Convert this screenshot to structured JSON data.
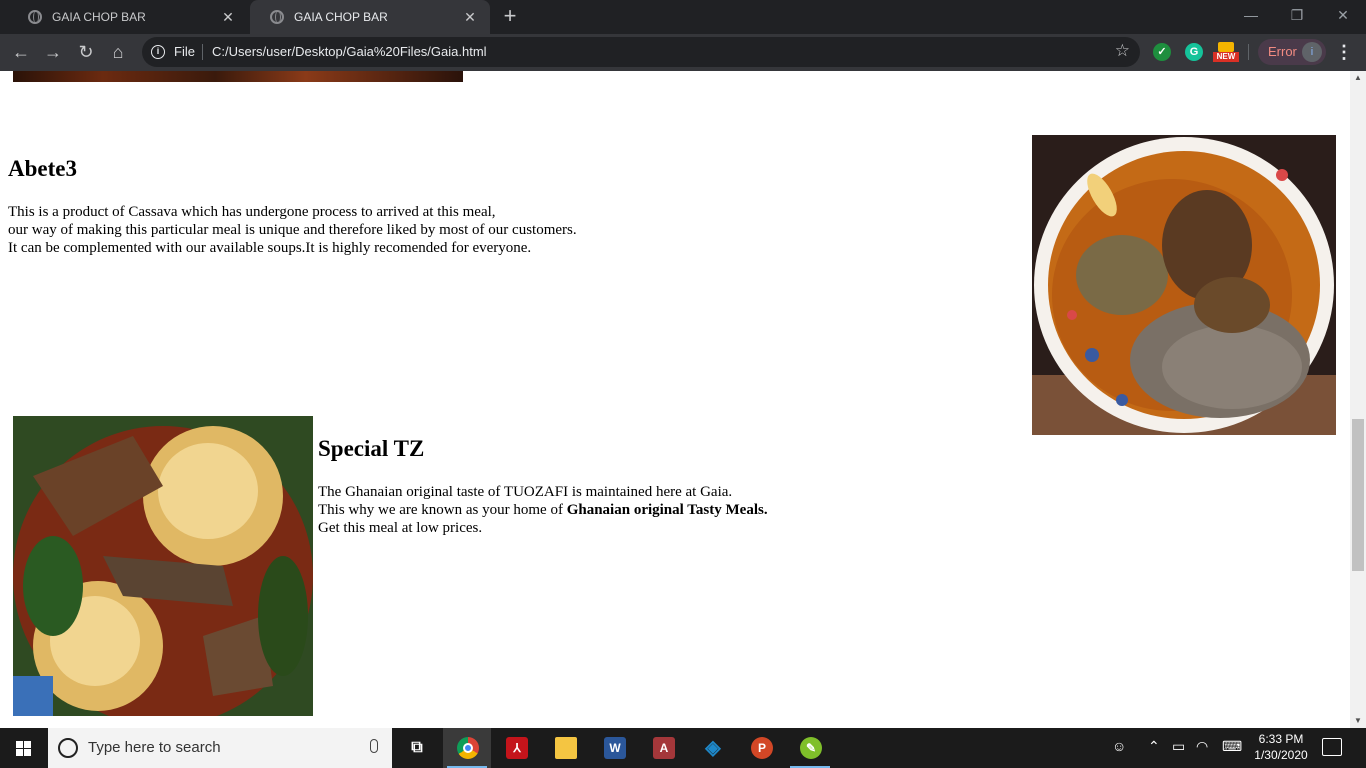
{
  "browser": {
    "tabs": [
      {
        "title": "GAIA CHOP BAR",
        "active": false
      },
      {
        "title": "GAIA CHOP BAR",
        "active": true
      }
    ],
    "address": {
      "scheme_label": "File",
      "url": "C:/Users/user/Desktop/Gaia%20Files/Gaia.html"
    },
    "extensions": {
      "grammarly": "G",
      "new_badge": "NEW"
    },
    "profile": {
      "status": "Error",
      "avatar_initial": "i"
    },
    "icons": {
      "back": "back-arrow-icon",
      "forward": "forward-arrow-icon",
      "reload": "reload-icon",
      "home": "home-icon",
      "bookmark": "star-icon",
      "menu": "kebab-menu-icon"
    }
  },
  "page": {
    "abete": {
      "heading": "Abete3",
      "lines": [
        "This is a product of Cassava which has undergone process to arrived at this meal,",
        "our way of making this particular meal is unique and therefore liked by most of our customers.",
        "It can be complemented with our available soups.It is highly recomended for everyone."
      ]
    },
    "tz": {
      "heading": "Special TZ",
      "line1": "The Ghanaian original taste of TUOZAFI is maintained here at Gaia.",
      "line2_prefix": "This why we are known as your home of ",
      "line2_bold": "Ghanaian original Tasty Meals.",
      "line3": "Get this meal at low prices."
    }
  },
  "taskbar": {
    "search_placeholder": "Type here to search",
    "apps": [
      {
        "name": "chrome",
        "label": "",
        "color": "#fbbc05"
      },
      {
        "name": "acrobat",
        "label": "",
        "color": "#c4141b"
      },
      {
        "name": "file-explorer",
        "label": "",
        "color": "#f4c542"
      },
      {
        "name": "word",
        "label": "W",
        "color": "#2b579a"
      },
      {
        "name": "access",
        "label": "A",
        "color": "#a4373a"
      },
      {
        "name": "sourcetree",
        "label": "",
        "color": "#1e88c9"
      },
      {
        "name": "powerpoint",
        "label": "P",
        "color": "#d24726"
      },
      {
        "name": "notepad-plus-plus",
        "label": "",
        "color": "#7fbf2a"
      }
    ],
    "clock": {
      "time": "6:33 PM",
      "date": "1/30/2020"
    }
  }
}
